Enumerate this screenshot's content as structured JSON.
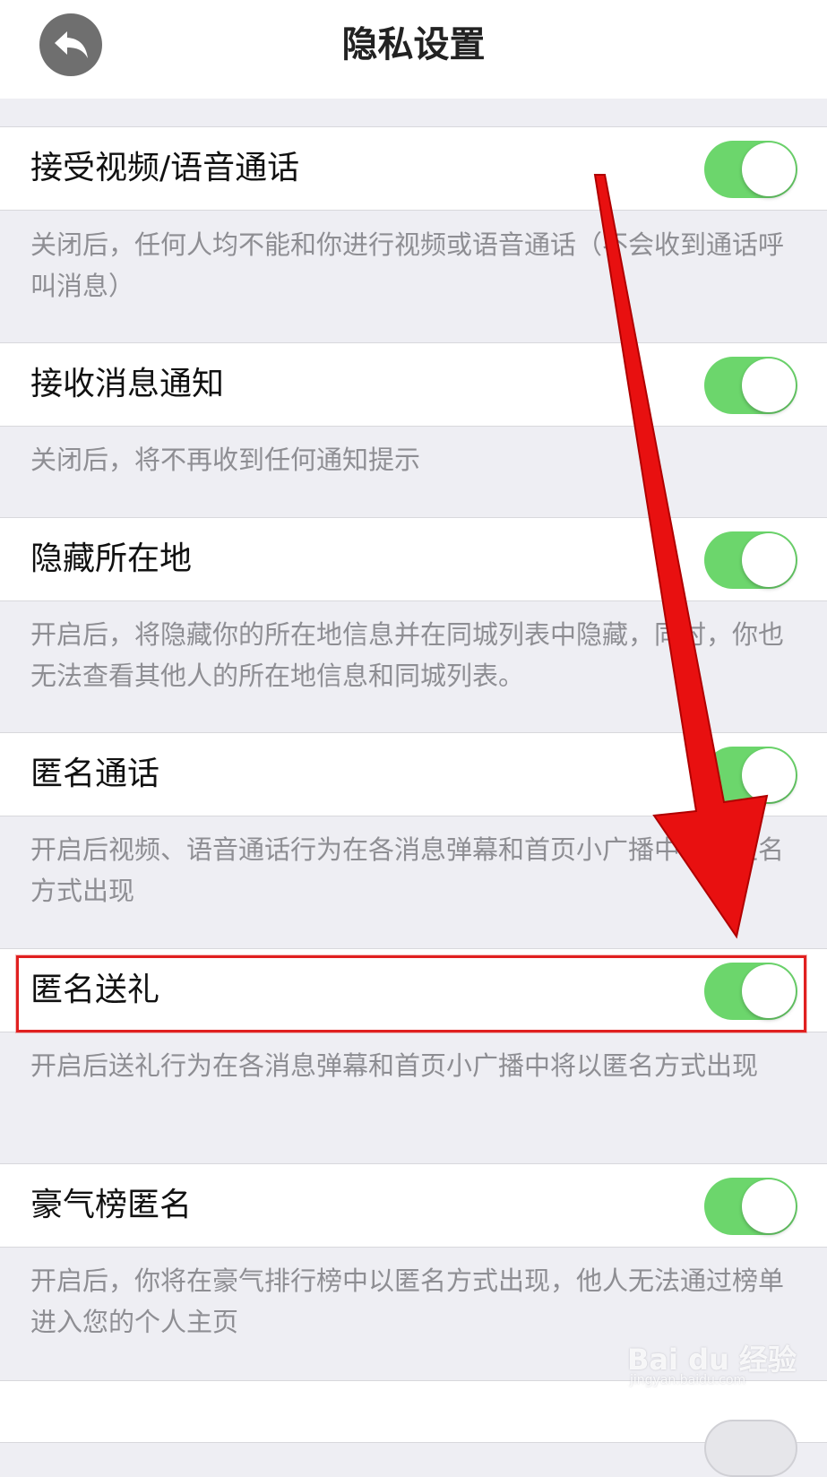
{
  "header": {
    "title": "隐私设置",
    "back_icon": "back-arrow-icon"
  },
  "settings": [
    {
      "label": "接受视频/语音通话",
      "enabled": true,
      "description": "关闭后，任何人均不能和你进行视频或语音通话（不会收到通话呼叫消息）"
    },
    {
      "label": "接收消息通知",
      "enabled": true,
      "description": "关闭后，将不再收到任何通知提示"
    },
    {
      "label": "隐藏所在地",
      "enabled": true,
      "description": "开启后，将隐藏你的所在地信息并在同城列表中隐藏，同时，你也无法查看其他人的所在地信息和同城列表。"
    },
    {
      "label": "匿名通话",
      "enabled": true,
      "description": "开启后视频、语音通话行为在各消息弹幕和首页小广播中将以匿名方式出现"
    },
    {
      "label": "匿名送礼",
      "enabled": true,
      "description": "开启后送礼行为在各消息弹幕和首页小广播中将以匿名方式出现"
    },
    {
      "label": "豪气榜匿名",
      "enabled": true,
      "description": "开启后，你将在豪气排行榜中以匿名方式出现，他人无法通过榜单进入您的个人主页"
    }
  ],
  "annotation": {
    "highlighted_item": "匿名送礼",
    "highlight_color": "#e02020",
    "arrow_color": "#e81010"
  },
  "colors": {
    "toggle_on": "#6cd66c",
    "background": "#eeeef3"
  },
  "watermark": {
    "logo": "Bai du 经验",
    "url": "jingyan.baidu.com"
  }
}
